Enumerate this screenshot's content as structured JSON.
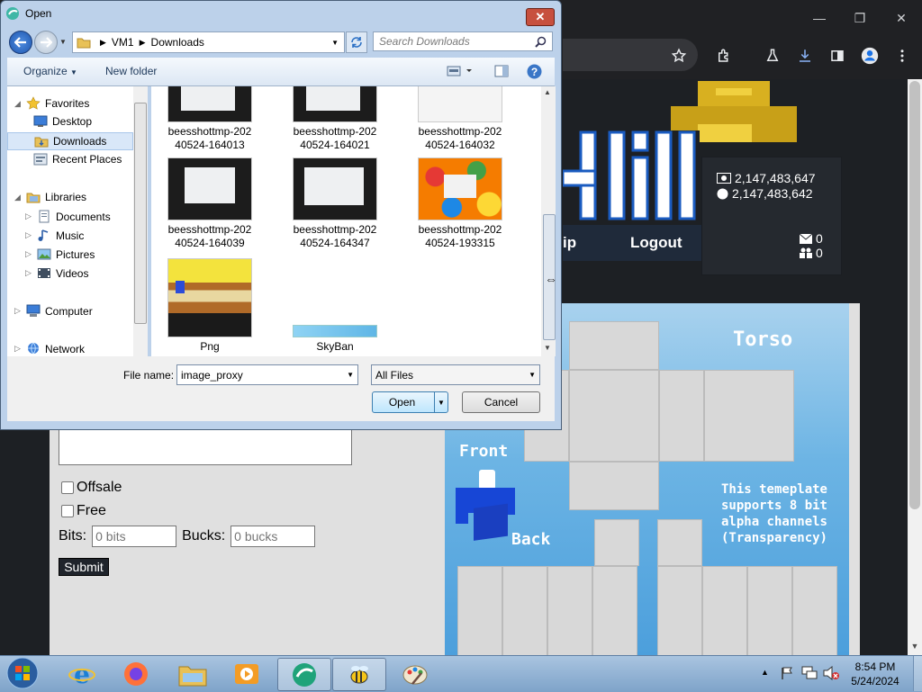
{
  "browser": {
    "controls": {
      "minimize": "—",
      "restore": "❐",
      "close": "✕"
    },
    "toolbar_icons": [
      "bookmark-star-icon",
      "extensions-icon",
      "labs-flask-icon",
      "download-icon",
      "sidebar-icon",
      "profile-icon",
      "menu-icon"
    ]
  },
  "site": {
    "ip_fragment": "ip",
    "logout": "Logout",
    "stats": {
      "bucks": "2,147,483,647",
      "bits": "2,147,483,642",
      "messages": "0",
      "friends": "0"
    },
    "form": {
      "offsale_label": "Offsale",
      "free_label": "Free",
      "bits_label": "Bits:",
      "bits_placeholder": "0 bits",
      "bucks_label": "Bucks:",
      "bucks_placeholder": "0 bucks",
      "submit_label": "Submit"
    },
    "template": {
      "torso": "Torso",
      "front": "Front",
      "back": "Back",
      "note": "This temeplate supports 8 bit alpha channels (Transparency)"
    }
  },
  "dialog": {
    "title": "Open",
    "breadcrumb": [
      "VM1",
      "Downloads"
    ],
    "search_placeholder": "Search Downloads",
    "organize": "Organize",
    "new_folder": "New folder",
    "nav": {
      "favorites": "Favorites",
      "desktop": "Desktop",
      "downloads": "Downloads",
      "recent": "Recent Places",
      "libraries": "Libraries",
      "documents": "Documents",
      "music": "Music",
      "pictures": "Pictures",
      "videos": "Videos",
      "computer": "Computer",
      "network": "Network"
    },
    "files": {
      "f1": {
        "line1": "beesshottmp-202",
        "line2": "40524-164013"
      },
      "f2": {
        "line1": "beesshottmp-202",
        "line2": "40524-164021"
      },
      "f3": {
        "line1": "beesshottmp-202",
        "line2": "40524-164032"
      },
      "f4": {
        "line1": "beesshottmp-202",
        "line2": "40524-164039"
      },
      "f5": {
        "line1": "beesshottmp-202",
        "line2": "40524-164347"
      },
      "f6": {
        "line1": "beesshottmp-202",
        "line2": "40524-193315"
      },
      "f7": {
        "line1": "Png"
      },
      "f8": {
        "line1": "SkyBan"
      }
    },
    "file_name_label": "File name:",
    "file_name_value": "image_proxy",
    "file_type": "All Files",
    "open_label": "Open",
    "cancel_label": "Cancel"
  },
  "taskbar": {
    "apps": [
      "start-orb",
      "internet-explorer",
      "firefox",
      "file-explorer",
      "media-player",
      "app-green",
      "bee-app",
      "paint"
    ],
    "time": "8:54 PM",
    "date": "5/24/2024"
  }
}
